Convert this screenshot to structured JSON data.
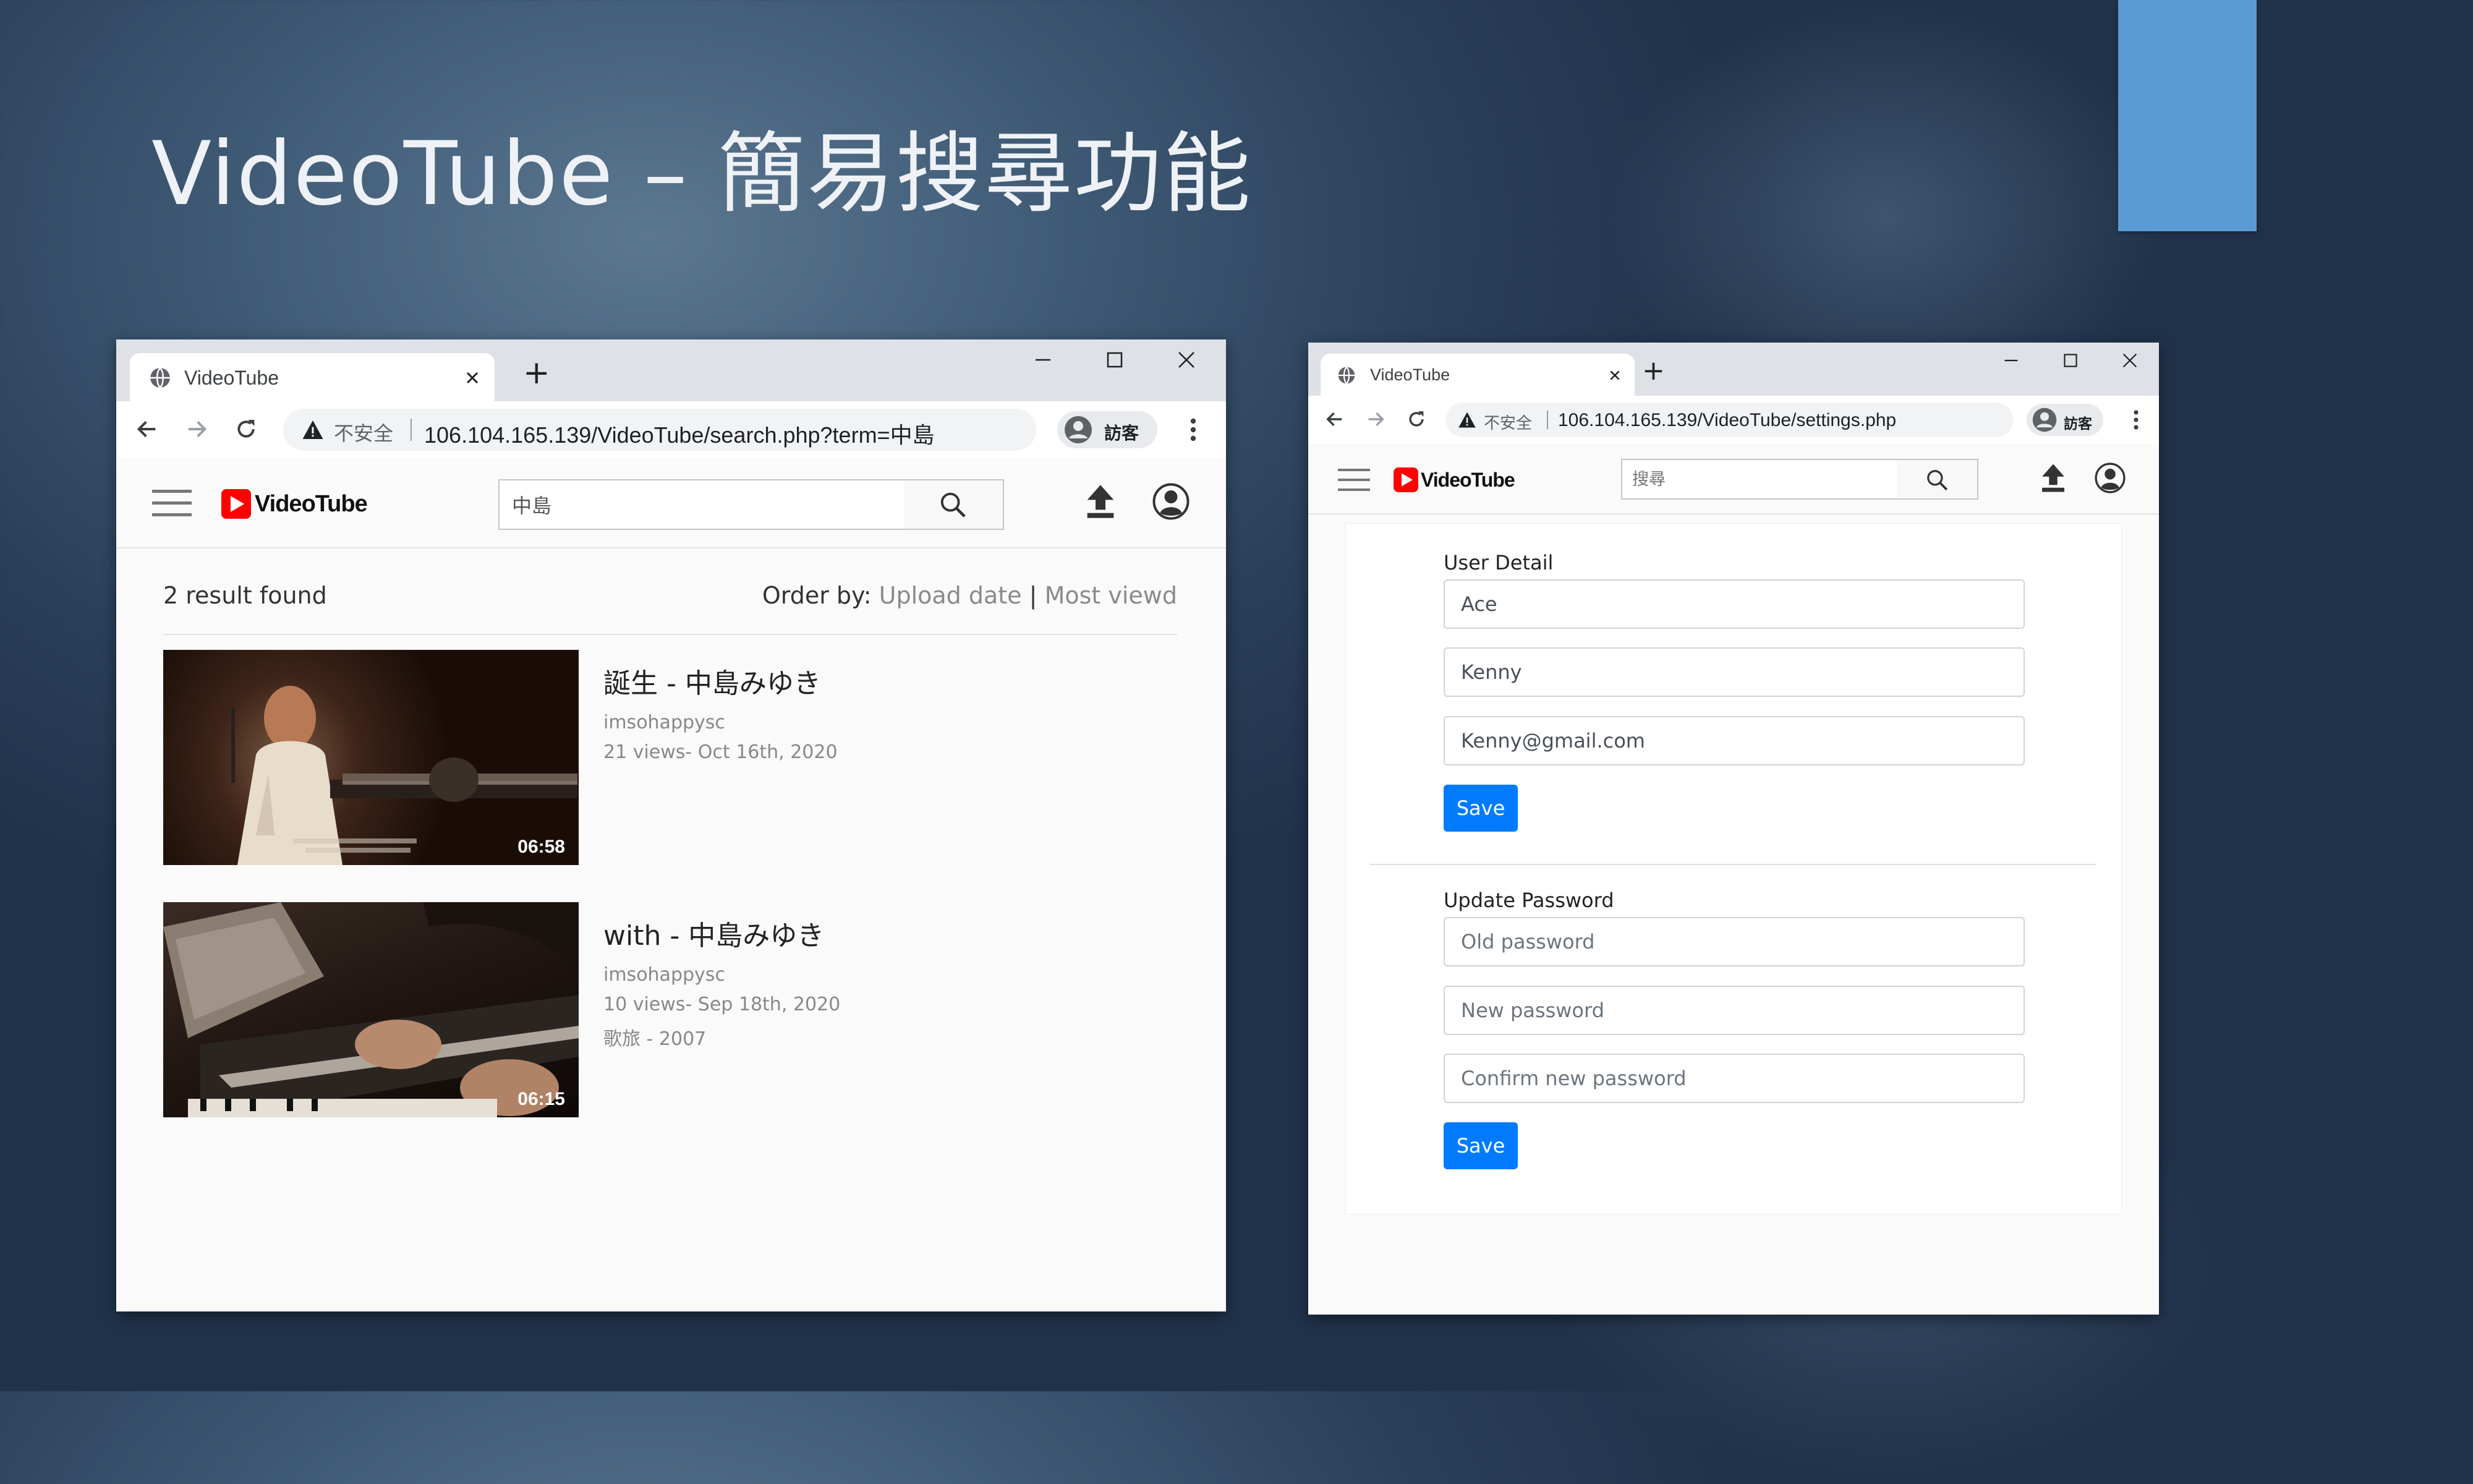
{
  "slide": {
    "title": "VideoTube – 簡易搜尋功能"
  },
  "colors": {
    "accent_rect": "#5b9bd5",
    "logo_red": "#ff0000",
    "save_button": "#007bff"
  },
  "left_window": {
    "tab_title": "VideoTube",
    "new_tab": "+",
    "insecure_label": "不安全",
    "url": "106.104.165.139/VideoTube/search.php?term=中島",
    "profile_name": "訪客",
    "site": {
      "logo_text": "VideoTube",
      "search_value": "中島"
    },
    "results": {
      "count_text": "2 result found",
      "order_by_label": "Order by:",
      "order_upload_date": "Upload date",
      "order_separator": "|",
      "order_most_viewed": "Most viewd"
    },
    "videos": [
      {
        "title": "誕生 - 中島みゆき",
        "channel": "imsohappysc",
        "meta": "21 views- Oct 16th, 2020",
        "extra": "",
        "duration": "06:58"
      },
      {
        "title": "with - 中島みゆき",
        "channel": "imsohappysc",
        "meta": "10 views- Sep 18th, 2020",
        "extra": "歌旅 - 2007",
        "duration": "06:15"
      }
    ]
  },
  "right_window": {
    "tab_title": "VideoTube",
    "new_tab": "+",
    "insecure_label": "不安全",
    "url": "106.104.165.139/VideoTube/settings.php",
    "profile_name": "訪客",
    "site": {
      "logo_text": "VideoTube",
      "search_placeholder": "搜尋"
    },
    "user_detail": {
      "label": "User Detail",
      "first_name": "Ace",
      "last_name": "Kenny",
      "email": "Kenny@gmail.com",
      "save_label": "Save"
    },
    "update_password": {
      "label": "Update Password",
      "old_placeholder": "Old password",
      "new_placeholder": "New password",
      "confirm_placeholder": "Confirm new password",
      "save_label": "Save"
    }
  }
}
